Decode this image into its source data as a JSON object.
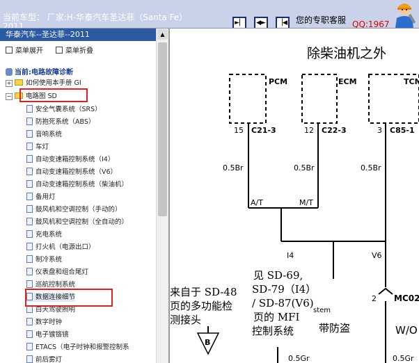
{
  "header": {
    "model_line1": "当前车型：  厂家:H-华泰汽车圣达菲（Santa Fe）",
    "model_line2": "2011",
    "service_label": "您的专职客服",
    "qq_link": "QQ:1967",
    "nav_icons": [
      "step-forward-icon",
      "expand-icon",
      "step-back-icon"
    ]
  },
  "sidebar": {
    "title": "华泰汽车--圣达菲--2011",
    "expand_label": "菜单展开",
    "collapse_label": "菜单折叠",
    "current_label": "当前:电路故障诊断",
    "folders": [
      "如何使用本手册 GI",
      "电路图 SD"
    ],
    "items": [
      "安全气囊系统（SRS）",
      "防抱死系统（ABS）",
      "音响系统",
      "车灯",
      "自动变速箱控制系统（I4）",
      "自动变速箱控制系统（V6）",
      "自动变速箱控制系统（柴油机）",
      "备用灯",
      "鼓风机和空调控制（手动的）",
      "鼓风机和空调控制（全自动的）",
      "充电系统",
      "打火机（电源出口）",
      "制冷系统",
      "仪表盘和组合尾灯",
      "巡航控制系统",
      "数据连接细节",
      "白天驾驶照明",
      "数字时钟",
      "电子镀铬镜",
      "ETACS（电子时钟和报警控制系",
      "前后雾灯"
    ]
  },
  "diagram": {
    "title": "除柴油机之外",
    "modules": [
      "PCM",
      "ECM",
      "TCM"
    ],
    "pins": [
      "15",
      "12",
      "3"
    ],
    "connectors": [
      "C21-3",
      "C22-3",
      "C85-1"
    ],
    "wire_labels": [
      "0.5Br",
      "0.5Br",
      "0.5Br"
    ],
    "junction_labels": [
      "A/T",
      "M/T"
    ],
    "branch_labels": [
      "I4",
      "V6"
    ],
    "note_left": [
      "来自于 SD-48",
      "页的多功能检",
      "测接头"
    ],
    "note_center": [
      "见 SD-69,",
      "SD-79（I4）",
      "/ SD-87(V6)",
      "页的 MFI",
      "控制系统"
    ],
    "partial_stem": "stem",
    "note_right": "带防盗",
    "mc_label": "MC02",
    "mc_pin": "2",
    "wo_label": "W/O",
    "bottom_wire_labels": [
      "0.5Gr",
      "0.5Gr"
    ],
    "ground_label": "B"
  }
}
